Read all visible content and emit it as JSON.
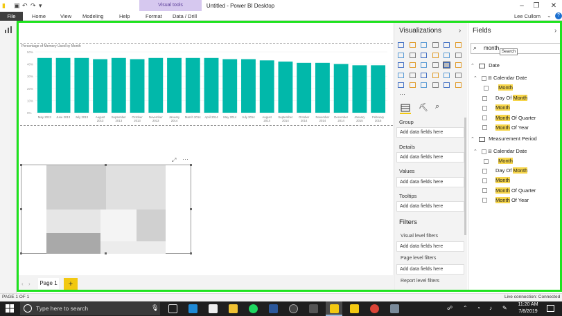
{
  "window": {
    "title": "Untitled - Power BI Desktop",
    "context_tab": "Visual tools",
    "user": "Lee Cullom"
  },
  "ribbon": {
    "file": "File",
    "tabs": [
      "Home",
      "View",
      "Modeling",
      "Help",
      "Format",
      "Data / Drill"
    ]
  },
  "chart_data": {
    "type": "bar",
    "title": "Percentage of Memory Used by Month",
    "categories": [
      "May 2013",
      "June 2013",
      "July 2013",
      "August 2013",
      "September 2013",
      "October 2013",
      "November 2013",
      "January 2014",
      "March 2014",
      "April 2014",
      "May 2014",
      "July 2014",
      "August 2014",
      "September 2014",
      "October 2014",
      "November 2014",
      "December 2014",
      "January 2015",
      "February 2015"
    ],
    "values": [
      45,
      45,
      45,
      44,
      45,
      44,
      45,
      45,
      45,
      45,
      44,
      44,
      43,
      42,
      41,
      41,
      40,
      39,
      39
    ],
    "y_ticks": [
      "50%",
      "40%",
      "30%",
      "20%",
      "10%",
      "0%"
    ],
    "ylim": [
      0,
      50
    ],
    "color": "#01b8aa"
  },
  "canvas": {
    "page_tab": "Page 1",
    "add_page": "+"
  },
  "visualizations": {
    "title": "Visualizations",
    "wells": [
      {
        "label": "Group",
        "placeholder": "Add data fields here"
      },
      {
        "label": "Details",
        "placeholder": "Add data fields here"
      },
      {
        "label": "Values",
        "placeholder": "Add data fields here"
      },
      {
        "label": "Tooltips",
        "placeholder": "Add data fields here"
      }
    ],
    "filters": {
      "title": "Filters",
      "visual_level": "Visual level filters",
      "visual_add": "Add data fields here",
      "page_level": "Page level filters",
      "page_add": "Add data fields here",
      "report_level": "Report level filters"
    }
  },
  "fields": {
    "title": "Fields",
    "search_value": "month",
    "search_tooltip": "Search",
    "tables": [
      {
        "name": "Date",
        "hierarchy": "Calendar Date",
        "hierarchy_child": "Month",
        "items": [
          {
            "prefix": "Day Of ",
            "match": "Month",
            "suffix": ""
          },
          {
            "prefix": "",
            "match": "Month",
            "suffix": ""
          },
          {
            "prefix": "",
            "match": "Month",
            "suffix": " Of Quarter"
          },
          {
            "prefix": "",
            "match": "Month",
            "suffix": " Of Year"
          }
        ]
      },
      {
        "name": "Measurement Period",
        "hierarchy": "Calendar Date",
        "hierarchy_child": "Month",
        "items": [
          {
            "prefix": "Day Of ",
            "match": "Month",
            "suffix": ""
          },
          {
            "prefix": "",
            "match": "Month",
            "suffix": ""
          },
          {
            "prefix": "",
            "match": "Month",
            "suffix": " Of Quarter"
          },
          {
            "prefix": "",
            "match": "Month",
            "suffix": " Of Year"
          }
        ]
      }
    ]
  },
  "status": {
    "page": "PAGE 1 OF 1",
    "connection": "Live connection: Connected"
  },
  "taskbar": {
    "search_placeholder": "Type here to search",
    "time": "11:20 AM",
    "date": "7/8/2019"
  }
}
